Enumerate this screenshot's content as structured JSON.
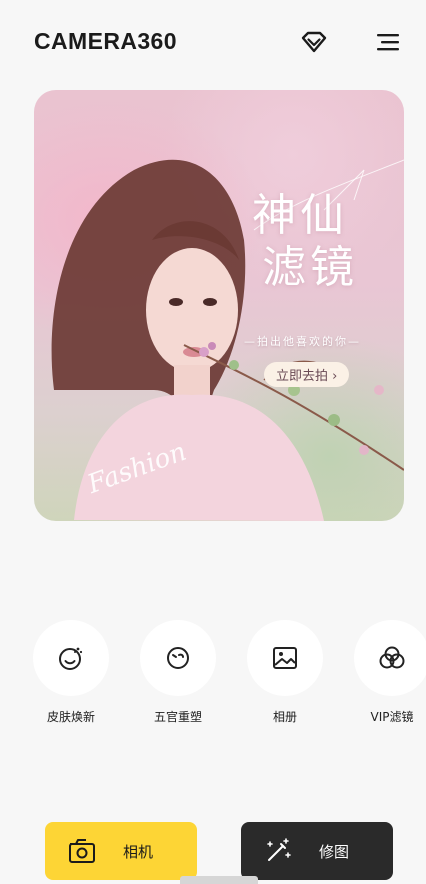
{
  "header": {
    "logo": "CAMERA360",
    "vip_icon": "diamond-icon",
    "menu_icon": "hamburger-menu-icon"
  },
  "banner": {
    "title_line1": "神仙",
    "title_line2": "滤镜",
    "subtitle": "—拍出他喜欢的你—",
    "cta": "立即去拍 ›",
    "script_text": "Fashion"
  },
  "features": [
    {
      "label": "皮肤焕新",
      "icon": "face-sparkle-icon"
    },
    {
      "label": "五官重塑",
      "icon": "face-reshape-icon"
    },
    {
      "label": "相册",
      "icon": "image-album-icon"
    },
    {
      "label": "VIP滤镜",
      "icon": "filter-circles-icon"
    }
  ],
  "bottom": {
    "camera_label": "相机",
    "edit_label": "修图"
  },
  "colors": {
    "accent_yellow": "#fdd535",
    "dark_button": "#2a2a2a",
    "background": "#f7f7f7"
  }
}
